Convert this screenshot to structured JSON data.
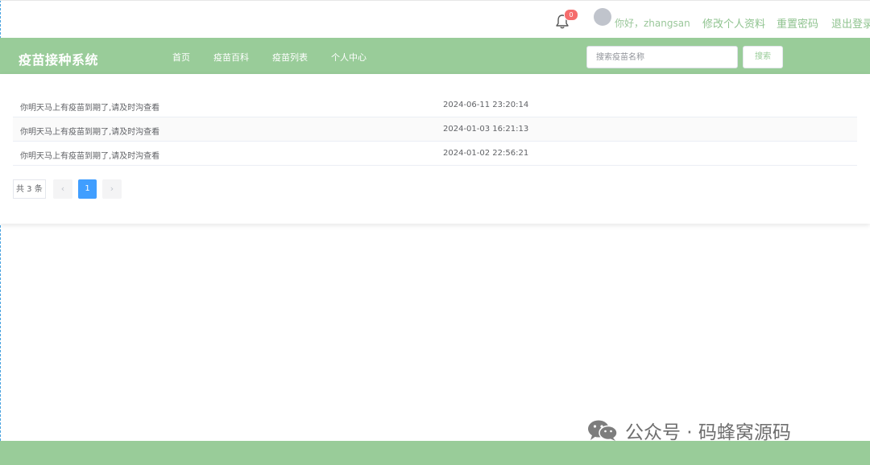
{
  "header": {
    "notification_count": "0",
    "greeting": "你好，zhangsan",
    "links": [
      "修改个人资料",
      "重置密码",
      "退出登录"
    ]
  },
  "nav": {
    "brand": "疫苗接种系统",
    "items": [
      "首页",
      "疫苗百科",
      "疫苗列表",
      "个人中心"
    ],
    "search_placeholder": "搜索疫苗名称",
    "search_button": "搜索"
  },
  "messages": {
    "rows": [
      {
        "text": "你明天马上有疫苗到期了,请及时沟查看",
        "time": "2024-06-11 23:20:14"
      },
      {
        "text": "你明天马上有疫苗到期了,请及时沟查看",
        "time": "2024-01-03 16:21:13"
      },
      {
        "text": "你明天马上有疫苗到期了,请及时沟查看",
        "time": "2024-01-02 22:56:21"
      }
    ]
  },
  "pagination": {
    "total": "共 3 条",
    "prev": "‹",
    "current": "1",
    "next": "›"
  },
  "watermark": {
    "text": "公众号 · 码蜂窝源码"
  },
  "colors": {
    "theme_green": "#99cc99",
    "pager_active": "#409eff",
    "badge_red": "#f56c6c"
  }
}
